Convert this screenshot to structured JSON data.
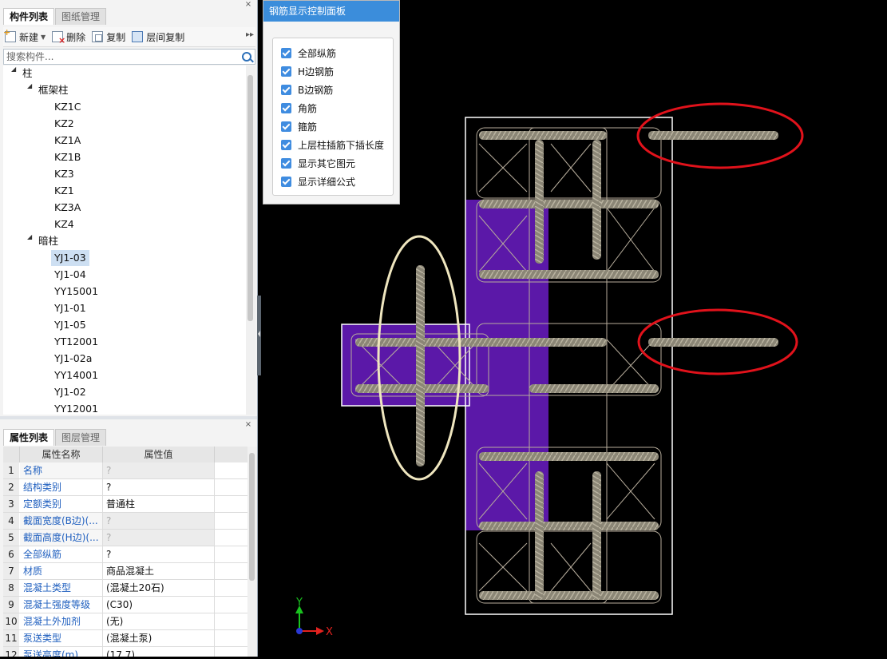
{
  "component_panel": {
    "tabs": [
      "构件列表",
      "图纸管理"
    ],
    "close": "×",
    "toolbar": {
      "new": "新建",
      "delete": "删除",
      "copy": "复制",
      "floor_copy": "层间复制",
      "more": "▸▸"
    },
    "search_placeholder": "搜索构件...",
    "tree": {
      "root": "柱",
      "groups": [
        {
          "label": "框架柱",
          "items": [
            "KZ1C",
            "KZ2",
            "KZ1A",
            "KZ1B",
            "KZ3",
            "KZ1",
            "KZ3A",
            "KZ4"
          ]
        },
        {
          "label": "暗柱",
          "items": [
            "YJ1-03",
            "YJ1-04",
            "YY15001",
            "YJ1-01",
            "YJ1-05",
            "YT12001",
            "YJ1-02a",
            "YY14001",
            "YJ1-02",
            "YY12001"
          ]
        }
      ],
      "selected": "YJ1-03"
    }
  },
  "property_panel": {
    "tabs": [
      "属性列表",
      "图层管理"
    ],
    "close": "×",
    "headers": [
      "属性名称",
      "属性值"
    ],
    "rows": [
      {
        "n": "1",
        "name": "名称",
        "value": "?",
        "grey": true
      },
      {
        "n": "2",
        "name": "结构类别",
        "value": "?",
        "grey": false
      },
      {
        "n": "3",
        "name": "定额类别",
        "value": "普通柱",
        "grey": false
      },
      {
        "n": "4",
        "name": "截面宽度(B边)(...",
        "value": "?",
        "grey": true
      },
      {
        "n": "5",
        "name": "截面高度(H边)(...",
        "value": "?",
        "grey": true
      },
      {
        "n": "6",
        "name": "全部纵筋",
        "value": "?",
        "grey": false
      },
      {
        "n": "7",
        "name": "材质",
        "value": "商品混凝土",
        "grey": false
      },
      {
        "n": "8",
        "name": "混凝土类型",
        "value": "(混凝土20石)",
        "grey": false
      },
      {
        "n": "9",
        "name": "混凝土强度等级",
        "value": "(C30)",
        "grey": false
      },
      {
        "n": "10",
        "name": "混凝土外加剂",
        "value": "(无)",
        "grey": false
      },
      {
        "n": "11",
        "name": "泵送类型",
        "value": "(混凝土泵)",
        "grey": false
      },
      {
        "n": "12",
        "name": "泵送高度(m)",
        "value": "(17.7)",
        "grey": false
      }
    ]
  },
  "control_panel": {
    "title": "钢筋显示控制面板",
    "options": [
      "全部纵筋",
      "H边钢筋",
      "B边钢筋",
      "角筋",
      "箍筋",
      "上层柱插筋下插长度",
      "显示其它图元",
      "显示详细公式"
    ]
  },
  "viewport": {
    "axis_x": "X",
    "axis_y": "Y",
    "colors": {
      "purple": "#5b18a8",
      "rebar": "#8b8676",
      "red_ellipse": "#e1121b",
      "cream_ellipse": "#efe6bf"
    }
  }
}
